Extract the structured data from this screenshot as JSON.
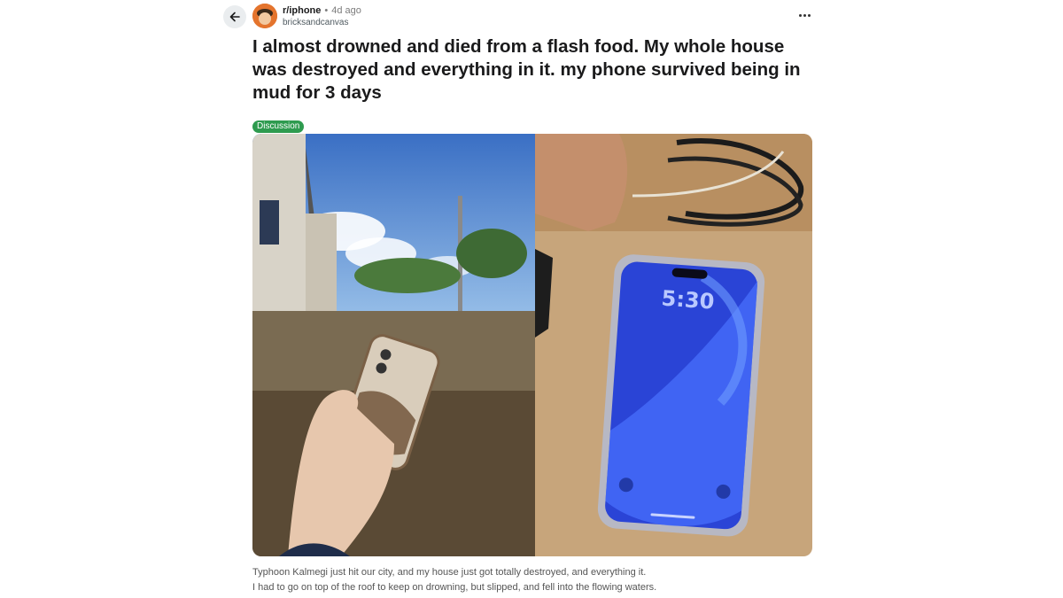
{
  "post": {
    "subreddit": "r/iphone",
    "separator": "•",
    "age": "4d ago",
    "username": "bricksandcanvas",
    "title": "I almost drowned and died from a flash food. My whole house was destroyed and everything in it. my phone survived being in mud for 3 days",
    "flair": "Discussion",
    "body_lines": [
      "Typhoon Kalmegi just hit our city, and my house just got totally destroyed, and everything it.",
      "I had to go on top of the roof to keep on drowning, but slipped, and fell into the flowing waters."
    ],
    "phone_lock_time": "5:30"
  },
  "icons": {
    "back": "arrow-left-icon",
    "more": "more-horizontal-icon"
  },
  "colors": {
    "flair": "#2e9b4f",
    "avatar": "#e4742d",
    "screen": "#2a44d6"
  }
}
